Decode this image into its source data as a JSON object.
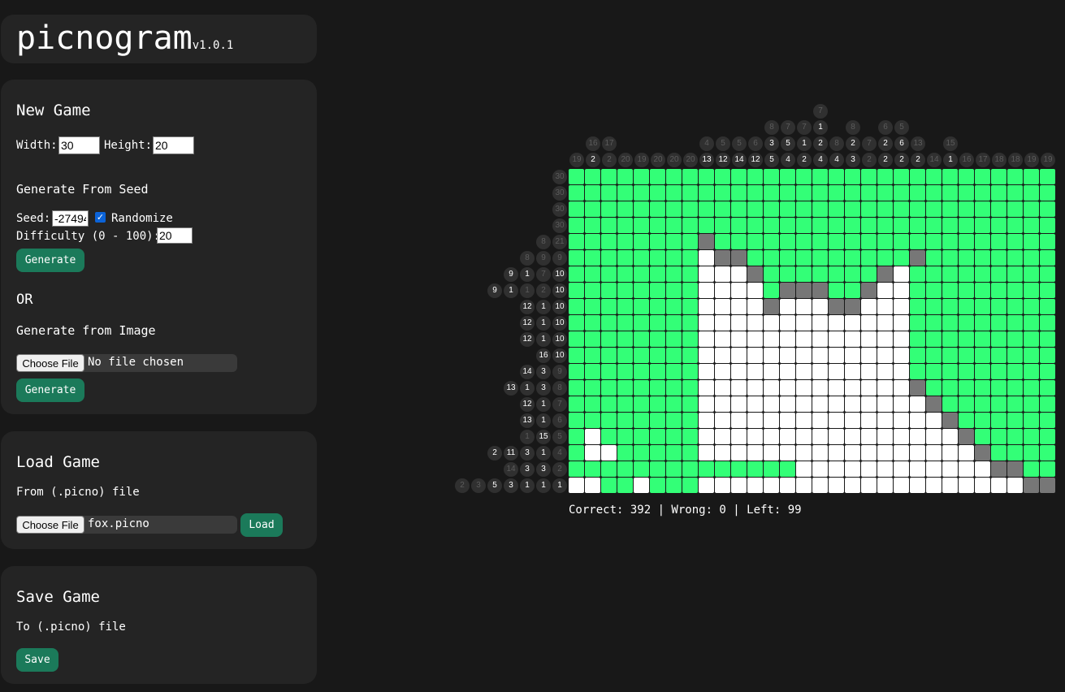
{
  "app": {
    "title": "picnogram",
    "version": "v1.0.1"
  },
  "new_game": {
    "heading": "New Game",
    "width_label": "Width:",
    "width_value": "30",
    "height_label": "Height:",
    "height_value": "20",
    "seed_section": "Generate From Seed",
    "seed_label": "Seed:",
    "seed_value": "-27494",
    "randomize_label": "Randomize",
    "randomize_checked": true,
    "difficulty_label": "Difficulty (0 - 100):",
    "difficulty_value": "20",
    "generate_label": "Generate",
    "or_label": "OR",
    "image_section": "Generate from Image",
    "choose_file_label": "Choose File",
    "no_file_label": "No file chosen",
    "generate_image_label": "Generate"
  },
  "load_game": {
    "heading": "Load Game",
    "subtitle": "From (.picno) file",
    "choose_file_label": "Choose File",
    "file_name": "fox.picno",
    "load_label": "Load"
  },
  "save_game": {
    "heading": "Save Game",
    "subtitle": "To (.picno) file",
    "save_label": "Save"
  },
  "stats": {
    "text": "Correct: 392 | Wrong: 0 | Left: 99"
  },
  "colors": {
    "filled": "#33ff77",
    "empty": "#ffffff",
    "marked": "#777777",
    "bg": "#181818",
    "panel": "#242424",
    "button": "#1b7a5a"
  },
  "puzzle": {
    "grid": [
      "GGGGGGGGGGGGGGGGGGGGGGGGGGGGGG",
      "GGGGGGGGGGGGGGGGGGGGGGGGGGGGGG",
      "GGGGGGGGGGGGGGGGGGGGGGGGGGGGGG",
      "GGGGGGGGGGGGGGGGGGGGGGGGGGGGGG",
      "GGGGGGGGXGGGGGGGGGGGGGGGGGGGGG",
      "GGGGGGGGWXXGGGGGGGGGGXGGGGGGGG",
      "GGGGGGGGWWWXGGGGGGGXWGGGGGGGGG",
      "GGGGGGGGWWWWGXXXGGXWWGGGGGGGGG",
      "GGGGGGGGWWWWXWWWXXWWWGGGGGGGGG",
      "GGGGGGGGWWWWWWWWWWWWWGGGGGGGGG",
      "GGGGGGGGWWWWWWWWWWWWWGGGGGGGGG",
      "GGGGGGGGWWWWWWWWWWWWWGGGGGGGGG",
      "GGGGGGGGWWWWWWWWWWWWWGGGGGGGGG",
      "GGGGGGGGWWWWWWWWWWWWWXGGGGGGGG",
      "GGGGGGGGWWWWWWWWWWWWWWXGGGGGGG",
      "GGGGGGGGWWWWWWWWWWWWWWWXGGGGGG",
      "GWGGGGGGWWWWWWWWWWWWWWWWXGGGGG",
      "GWWGGGGGWWWWWWWWWWWWWWWWWXGGGG",
      "GGGGGGGGGGGGGGWWWWWWWWWWWWXXGG",
      "WWGGWGGGWWWWWWWWWWWWWWWWWWWWXX"
    ],
    "col_clues": [
      [
        [
          "19",
          0
        ]
      ],
      [
        [
          "16",
          0
        ],
        [
          "2",
          1
        ]
      ],
      [
        [
          "17",
          0
        ],
        [
          "2",
          0
        ]
      ],
      [
        [
          "20",
          0
        ]
      ],
      [
        [
          "19",
          0
        ]
      ],
      [
        [
          "20",
          0
        ]
      ],
      [
        [
          "20",
          0
        ]
      ],
      [
        [
          "20",
          0
        ]
      ],
      [
        [
          "4",
          0
        ],
        [
          "13",
          1
        ]
      ],
      [
        [
          "5",
          0
        ],
        [
          "12",
          1
        ]
      ],
      [
        [
          "5",
          0
        ],
        [
          "14",
          1
        ]
      ],
      [
        [
          "6",
          0
        ],
        [
          "12",
          1
        ]
      ],
      [
        [
          "8",
          0
        ],
        [
          "3",
          1
        ],
        [
          "5",
          1
        ]
      ],
      [
        [
          "7",
          0
        ],
        [
          "5",
          1
        ],
        [
          "4",
          1
        ]
      ],
      [
        [
          "7",
          0
        ],
        [
          "1",
          1
        ],
        [
          "2",
          1
        ]
      ],
      [
        [
          "7",
          0
        ],
        [
          "1",
          1
        ],
        [
          "2",
          1
        ],
        [
          "4",
          1
        ]
      ],
      [
        [
          "8",
          0
        ],
        [
          "4",
          1
        ]
      ],
      [
        [
          "8",
          0
        ],
        [
          "2",
          1
        ],
        [
          "3",
          1
        ]
      ],
      [
        [
          "7",
          0
        ],
        [
          "2",
          0
        ]
      ],
      [
        [
          "6",
          0
        ],
        [
          "2",
          1
        ],
        [
          "2",
          1
        ]
      ],
      [
        [
          "5",
          0
        ],
        [
          "6",
          1
        ],
        [
          "2",
          1
        ]
      ],
      [
        [
          "13",
          0
        ],
        [
          "2",
          1
        ]
      ],
      [
        [
          "14",
          0
        ]
      ],
      [
        [
          "15",
          0
        ],
        [
          "1",
          1
        ]
      ],
      [
        [
          "16",
          0
        ]
      ],
      [
        [
          "17",
          0
        ]
      ],
      [
        [
          "18",
          0
        ]
      ],
      [
        [
          "18",
          0
        ]
      ],
      [
        [
          "19",
          0
        ]
      ],
      [
        [
          "19",
          0
        ]
      ]
    ],
    "row_clues": [
      [
        [
          "30",
          0
        ]
      ],
      [
        [
          "30",
          0
        ]
      ],
      [
        [
          "30",
          0
        ]
      ],
      [
        [
          "30",
          0
        ]
      ],
      [
        [
          "8",
          0
        ],
        [
          "21",
          0
        ]
      ],
      [
        [
          "8",
          0
        ],
        [
          "9",
          0
        ],
        [
          "9",
          0
        ]
      ],
      [
        [
          "9",
          1
        ],
        [
          "1",
          1
        ],
        [
          "7",
          0
        ],
        [
          "10",
          1
        ]
      ],
      [
        [
          "9",
          1
        ],
        [
          "1",
          1
        ],
        [
          "1",
          0
        ],
        [
          "2",
          0
        ],
        [
          "10",
          1
        ]
      ],
      [
        [
          "12",
          1
        ],
        [
          "1",
          1
        ],
        [
          "10",
          1
        ]
      ],
      [
        [
          "12",
          1
        ],
        [
          "1",
          1
        ],
        [
          "10",
          1
        ]
      ],
      [
        [
          "12",
          1
        ],
        [
          "1",
          1
        ],
        [
          "10",
          1
        ]
      ],
      [
        [
          "16",
          1
        ],
        [
          "10",
          1
        ]
      ],
      [
        [
          "14",
          1
        ],
        [
          "3",
          1
        ],
        [
          "9",
          0
        ]
      ],
      [
        [
          "13",
          1
        ],
        [
          "1",
          1
        ],
        [
          "3",
          1
        ],
        [
          "8",
          0
        ]
      ],
      [
        [
          "12",
          1
        ],
        [
          "1",
          1
        ],
        [
          "7",
          0
        ]
      ],
      [
        [
          "13",
          1
        ],
        [
          "1",
          1
        ],
        [
          "6",
          0
        ]
      ],
      [
        [
          "1",
          0
        ],
        [
          "15",
          1
        ],
        [
          "5",
          0
        ]
      ],
      [
        [
          "2",
          1
        ],
        [
          "11",
          1
        ],
        [
          "3",
          1
        ],
        [
          "1",
          1
        ],
        [
          "4",
          0
        ]
      ],
      [
        [
          "14",
          0
        ],
        [
          "3",
          1
        ],
        [
          "3",
          1
        ],
        [
          "2",
          0
        ]
      ],
      [
        [
          "2",
          0
        ],
        [
          "3",
          0
        ],
        [
          "5",
          1
        ],
        [
          "3",
          1
        ],
        [
          "1",
          1
        ],
        [
          "1",
          1
        ],
        [
          "1",
          1
        ]
      ]
    ]
  }
}
